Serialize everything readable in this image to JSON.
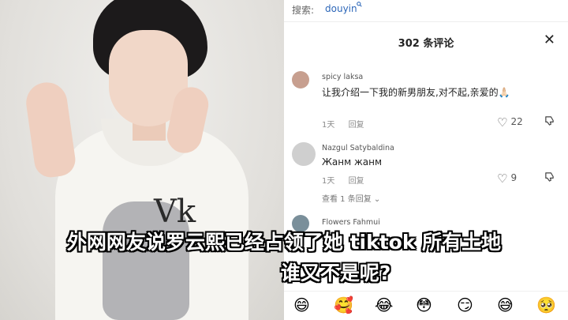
{
  "search": {
    "label": "搜索:",
    "query": "douyin",
    "query_icon": "search-icon"
  },
  "header": {
    "comment_count": "302 条评论",
    "close_glyph": "✕"
  },
  "comments": [
    {
      "username": "spicy laksa",
      "text": "让我介绍一下我的新男朋友,对不起,亲爱的🙏🏻",
      "time": "1天",
      "reply_label": "回复",
      "likes": "22",
      "avatar_color": "#c79f8f"
    },
    {
      "username": "Nazgul Satybaldina",
      "text": "Жанм жанм",
      "time": "1天",
      "reply_label": "回复",
      "likes": "9",
      "avatar_color": "#cfcfcf",
      "view_replies": "查看 1 条回复"
    },
    {
      "username": "Flowers Fahmui",
      "avatar_color": "#7a8f9a"
    }
  ],
  "emoji_bar": [
    "😄",
    "🥰",
    "😂",
    "😳",
    "😏",
    "😅",
    "🥺"
  ],
  "caption": {
    "line1": "外网网友说罗云熙已经占领了她 tiktok 所有土地",
    "line2": "谁又不是呢?",
    "line2_emoji": "😍"
  },
  "photo": {
    "logo_text": "Vk"
  },
  "colors": {
    "accent_link": "#2c66b8"
  }
}
